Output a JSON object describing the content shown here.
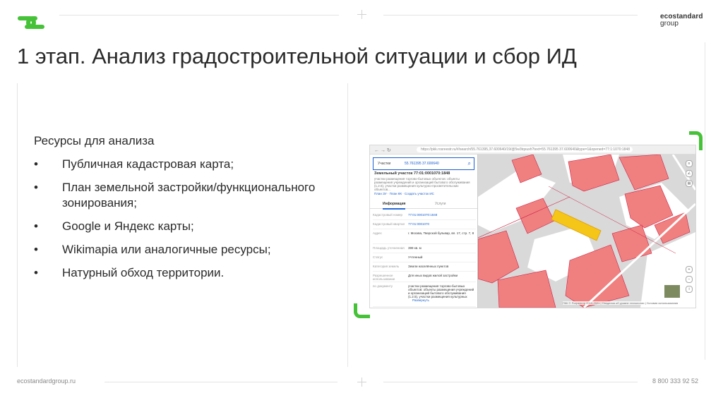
{
  "header": {
    "brand_line1": "ecostandard",
    "brand_line2": "group",
    "title": "1 этап. Анализ градостроительной ситуации и сбор ИД"
  },
  "resources": {
    "heading": "Ресурсы для анализа",
    "bullet": "•",
    "items": [
      "Публичная кадастровая карта;",
      "План земельной застройки/функционального зонирования;",
      "Google и Яндекс карты;",
      "Wikimapia или аналогичные ресурсы;",
      "Натурный обход территории."
    ]
  },
  "screenshot": {
    "url": "https://pkk.rosreestr.ru/#/search/55.761395,37.600640/19/@5w3tqxuxh?text=55.761395 37.600640&type=1&opened=77:1:1070:1848",
    "search_type": "Участки",
    "search_query": "55.761395 37.600640",
    "parcel_title": "Земельный участок 77:01:0001070:1848",
    "parcel_note": "участки размещения торгово-бытовых объектов: объекты размещения учреждений и организаций бытового обслуживания (1.2.5), участки размещения культурно-просветительских объектов...",
    "links": "План ЗУ · План КК · Создать участок ИС",
    "tab_info": "Информация",
    "tab_services": "Услуги",
    "rows": [
      {
        "k": "Кадастровый номер",
        "v": "77:01:0001070:1848",
        "link": true
      },
      {
        "k": "Кадастровый квартал",
        "v": "77:01:0001070",
        "link": true
      },
      {
        "k": "Адрес",
        "v": "г. Москва, Тверской бульвар, вл. 17, стр. 7, 8",
        "link": false
      },
      {
        "k": "Площадь уточненная",
        "v": "399 кв. м",
        "link": false
      },
      {
        "k": "Статус",
        "v": "Учтенный",
        "link": false
      },
      {
        "k": "Категория земель",
        "v": "Земли населённых пунктов",
        "link": false
      },
      {
        "k": "Разрешенное использование",
        "v": "Для иных видов жилой застройки",
        "link": false
      },
      {
        "k": "по документу",
        "v": "участки размещения торгово-бытовых объектов: объекты размещения учреждений и организаций бытового обслуживания (1.2.5), участки размещения культурных",
        "link": false
      }
    ],
    "bottom_link": "Развернуть",
    "attribution": "ПКК © Росреестр 2010-2021 | Сведения об уровне технологии | Условия использования"
  },
  "footer": {
    "website": "ecostandardgroup.ru",
    "phone": "8 800 333 92 52"
  },
  "colors": {
    "accent_green": "#46c238",
    "parcel_fill": "#f08080",
    "road_gray": "#d9d9d9",
    "highlight_yellow": "#f5c518"
  }
}
